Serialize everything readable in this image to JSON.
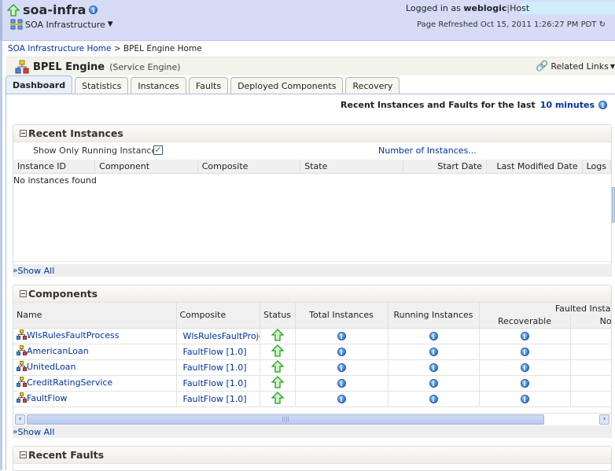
{
  "header": {
    "title": "soa-infra",
    "menu_label": "SOA Infrastructure",
    "logged_in_prefix": "Logged in as",
    "user": "weblogic",
    "host_label": "Host",
    "refresh_text": "Page Refreshed Oct 15, 2011 1:26:27 PM PDT"
  },
  "breadcrumb": {
    "home": "SOA Infrastructure Home",
    "separator": ">",
    "current": "BPEL Engine Home"
  },
  "engine": {
    "title": "BPEL Engine",
    "subtitle": "(Service Engine)",
    "related_links": "Related Links"
  },
  "tabs": [
    {
      "label": "Dashboard",
      "active": true
    },
    {
      "label": "Statistics"
    },
    {
      "label": "Instances"
    },
    {
      "label": "Faults"
    },
    {
      "label": "Deployed Components"
    },
    {
      "label": "Recovery"
    }
  ],
  "recent_line": {
    "prefix": "Recent Instances and Faults for the last",
    "period": "10 minutes"
  },
  "recent_instances": {
    "title": "Recent Instances",
    "filter_label": "Show Only Running Instances",
    "filter_checked": true,
    "number_link": "Number of Instances...",
    "columns": [
      "Instance ID",
      "Component",
      "Composite",
      "State",
      "Start Date",
      "Last Modified Date",
      "Logs"
    ],
    "empty_text": "No instances found",
    "show_all": "Show All"
  },
  "components": {
    "title": "Components",
    "columns": {
      "name": "Name",
      "composite": "Composite",
      "status": "Status",
      "total": "Total Instances",
      "running": "Running Instances",
      "faulted_group": "Faulted Instances",
      "recoverable": "Recoverable",
      "non_recoverable": "Non Re"
    },
    "rows": [
      {
        "name": "WlsRulesFaultProcess",
        "composite": "WlsRulesFaultProjec",
        "status": "up"
      },
      {
        "name": "AmericanLoan",
        "composite": "FaultFlow [1.0]",
        "status": "up"
      },
      {
        "name": "UnitedLoan",
        "composite": "FaultFlow [1.0]",
        "status": "up"
      },
      {
        "name": "CreditRatingService",
        "composite": "FaultFlow [1.0]",
        "status": "up"
      },
      {
        "name": "FaultFlow",
        "composite": "FaultFlow [1.0]",
        "status": "up"
      }
    ],
    "show_all": "Show All"
  },
  "recent_faults": {
    "title": "Recent Faults"
  },
  "colors": {
    "header_bg": "#d6dcf6",
    "link": "#003399",
    "status_up": "#3fbf3f"
  }
}
